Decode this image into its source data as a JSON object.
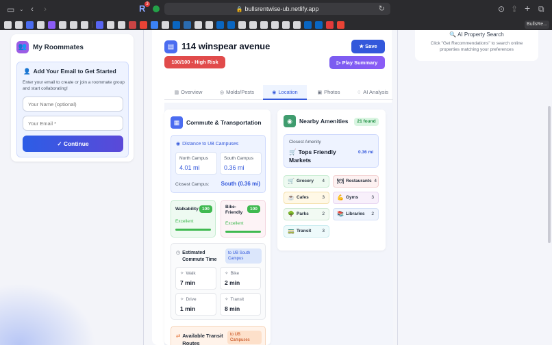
{
  "browser": {
    "url": "bullsrentwise-ub.netlify.app",
    "extension_badge": "3",
    "last_bookmark": "BullsRe..."
  },
  "sidebar": {
    "roommates_title": "My Roommates",
    "email_heading": "Add Your Email to Get Started",
    "email_description": "Enter your email to create or join a roommate group and start collaborating!",
    "name_placeholder": "Your Name (optional)",
    "email_placeholder": "Your Email *",
    "continue_label": "Continue"
  },
  "ai_search": {
    "title": "AI Property Search",
    "description": "Click \"Get Recommendations\" to search online properties matching your preferences"
  },
  "property": {
    "title": "114 winspear avenue",
    "save_label": "Save",
    "risk_badge": "100/100 - High Risk",
    "play_summary_label": "Play Summary"
  },
  "tabs": [
    {
      "label": "Overview",
      "icon": "bar-chart-icon"
    },
    {
      "label": "Molds/Pests",
      "icon": "bug-icon"
    },
    {
      "label": "Location",
      "icon": "location-pin-icon",
      "active": true
    },
    {
      "label": "Photos",
      "icon": "image-icon"
    },
    {
      "label": "AI Analysis",
      "icon": "lightbulb-icon"
    }
  ],
  "commute": {
    "title": "Commute & Transportation",
    "distance_heading": "Distance to UB Campuses",
    "north_label": "North Campus",
    "north_value": "4.01 mi",
    "south_label": "South Campus",
    "south_value": "0.36 mi",
    "closest_label": "Closest Campus:",
    "closest_value": "South (0.36 mi)",
    "walkability_label": "Walkability",
    "walkability_score": "100",
    "walkability_rating": "Excellent",
    "bike_label": "Bike-Friendly",
    "bike_score": "100",
    "bike_rating": "Excellent",
    "estimated_heading": "Estimated Commute Time",
    "estimated_badge": "to UB South Campus",
    "modes": [
      {
        "label": "Walk",
        "value": "7 min"
      },
      {
        "label": "Bike",
        "value": "2 min"
      },
      {
        "label": "Drive",
        "value": "1 min"
      },
      {
        "label": "Transit",
        "value": "8 min"
      }
    ],
    "transit_heading": "Available Transit Routes",
    "transit_badge": "to UB Campuses"
  },
  "amenities": {
    "title": "Nearby Amenities",
    "found_badge": "21 found",
    "closest_label": "Closest Amenity",
    "closest_name": "Tops Friendly Markets",
    "closest_distance": "0.36 mi",
    "categories": [
      {
        "label": "Grocery",
        "count": "4",
        "emoji": "🛒"
      },
      {
        "label": "Restaurants",
        "count": "4",
        "emoji": "🍽"
      },
      {
        "label": "Cafes",
        "count": "3",
        "emoji": "☕"
      },
      {
        "label": "Gyms",
        "count": "3",
        "emoji": "💪"
      },
      {
        "label": "Parks",
        "count": "2",
        "emoji": "🌳"
      },
      {
        "label": "Libraries",
        "count": "2",
        "emoji": "📚"
      },
      {
        "label": "Transit",
        "count": "3",
        "emoji": "🚃"
      }
    ]
  },
  "colors": {
    "accent": "#3358db",
    "risk": "#e14b4b",
    "purple": "#8b5cf6",
    "success": "#3fb950"
  }
}
